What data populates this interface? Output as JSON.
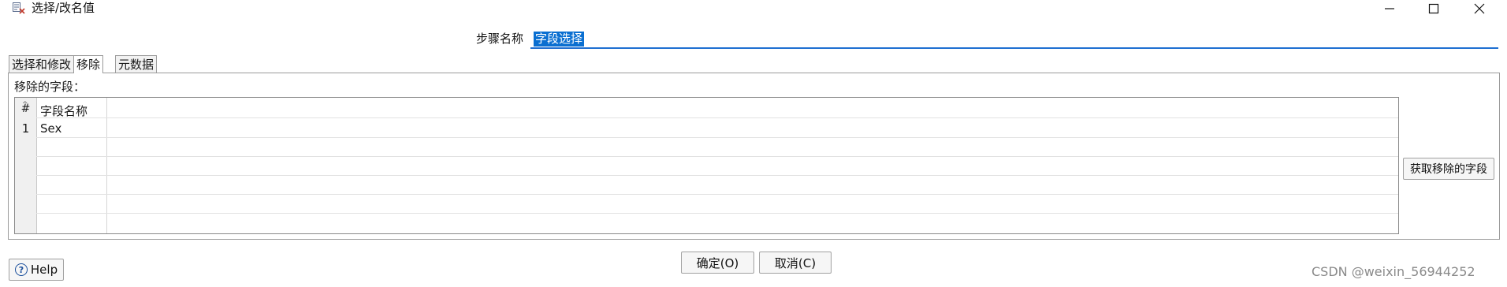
{
  "window": {
    "title": "选择/改名值",
    "app_icon": "select-rename-icon",
    "controls": {
      "minimize_icon": "minimize-icon",
      "maximize_icon": "maximize-icon",
      "close_icon": "close-icon"
    }
  },
  "step": {
    "label": "步骤名称",
    "value": "字段选择"
  },
  "tabs": [
    {
      "label": "选择和修改",
      "active": false
    },
    {
      "label": "移除",
      "active": true
    },
    {
      "label": "元数据",
      "active": false
    }
  ],
  "remove_panel": {
    "section_label": "移除的字段：",
    "table": {
      "columns": [
        "#",
        "字段名称"
      ],
      "rows": [
        {
          "num": "1",
          "name": "Sex"
        }
      ]
    },
    "get_fields_button": "获取移除的字段"
  },
  "footer": {
    "help_label": "Help",
    "help_icon": "help-icon",
    "ok_label": "确定(O)",
    "cancel_label": "取消(C)"
  },
  "watermark": "CSDN @weixin_56944252",
  "colors": {
    "selection": "#0a6fd1",
    "input_underline": "#1f6fd1"
  }
}
